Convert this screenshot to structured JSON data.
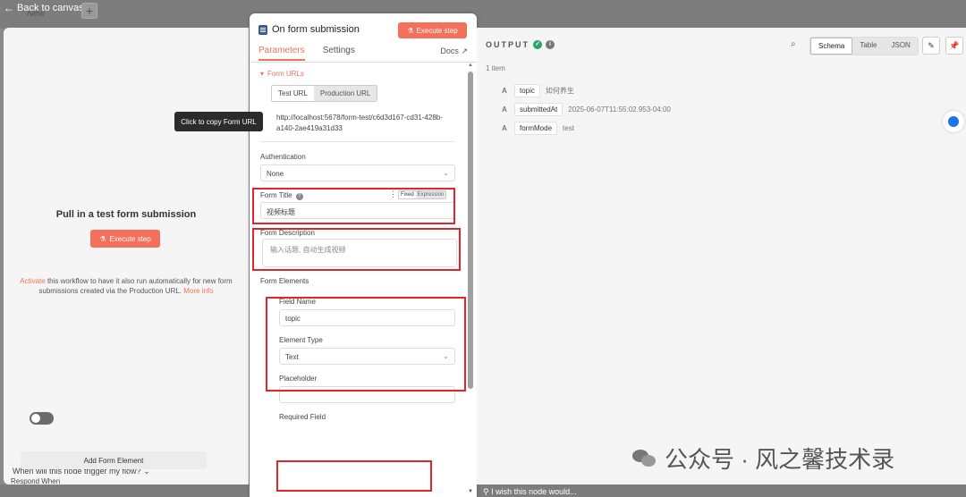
{
  "canvas": {
    "back_label": "Back to canvas",
    "ghost_tab": "New",
    "plus": "+",
    "feedback": "I wish this node would..."
  },
  "left": {
    "heading": "Pull in a test form submission",
    "execute_label": "Execute step",
    "activate_link": "Activate",
    "activate_text": " this workflow to have it also run automatically for new form submissions created via the Production URL. ",
    "more_info": "More info",
    "when_label": "When will this node trigger my flow?"
  },
  "node": {
    "title": "On form submission",
    "execute_label": "Execute step",
    "tabs": [
      "Parameters",
      "Settings"
    ],
    "docs_label": "Docs",
    "form_urls_label": "Form URLs",
    "url_tabs": [
      "Test URL",
      "Production URL"
    ],
    "tooltip": "Click to copy Form URL",
    "url": "http://localhost:5678/form-test/c6d3d167-cd31-428b-a140-2ae419a31d33",
    "authentication_label": "Authentication",
    "authentication_value": "None",
    "form_title_label": "Form Title",
    "fixed_label": "Fixed",
    "expression_label": "Expression",
    "form_title_value": "视频标题",
    "form_description_label": "Form Description",
    "form_description_placeholder": "输入话题, 自动生成视频",
    "form_elements_label": "Form Elements",
    "field_name_label": "Field Name",
    "field_name_value": "topic",
    "element_type_label": "Element Type",
    "element_type_value": "Text",
    "placeholder_label": "Placeholder",
    "placeholder_value": "",
    "required_label": "Required Field",
    "add_element_label": "Add Form Element",
    "respond_when_label": "Respond When"
  },
  "output": {
    "title": "OUTPUT",
    "items_count": "1 item",
    "view_tabs": [
      "Schema",
      "Table",
      "JSON"
    ],
    "rows": [
      {
        "type": "A",
        "key": "topic",
        "value": "如何养生"
      },
      {
        "type": "A",
        "key": "submittedAt",
        "value": "2025-06-07T11:55:02.953-04:00"
      },
      {
        "type": "A",
        "key": "formMode",
        "value": "test"
      }
    ]
  },
  "watermark": "公众号 · 风之馨技术录",
  "colors": {
    "accent": "#f4705a",
    "highlight": "#e0262a",
    "success": "#29a36a"
  }
}
